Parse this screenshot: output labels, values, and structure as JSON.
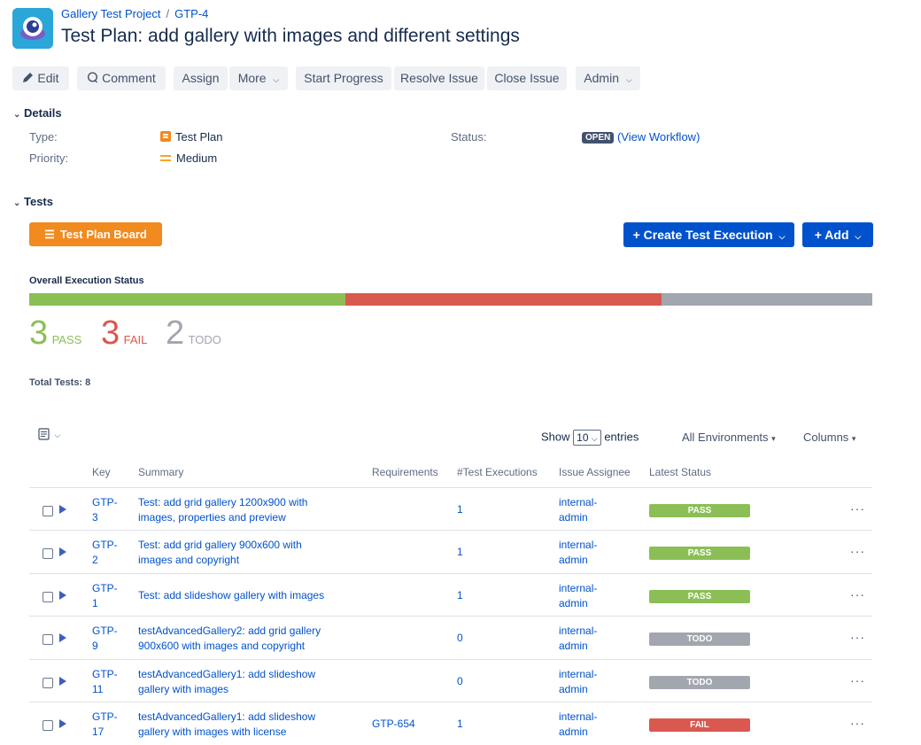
{
  "header": {
    "project": "Gallery Test Project",
    "separator": "/",
    "issue_key": "GTP-4",
    "title": "Test Plan: add gallery with images and different settings"
  },
  "toolbar": {
    "edit": "Edit",
    "comment": "Comment",
    "assign": "Assign",
    "more": "More",
    "start_progress": "Start Progress",
    "resolve_issue": "Resolve Issue",
    "close_issue": "Close Issue",
    "admin": "Admin"
  },
  "details": {
    "heading": "Details",
    "type_label": "Type:",
    "type_value": "Test Plan",
    "priority_label": "Priority:",
    "priority_value": "Medium",
    "status_label": "Status:",
    "status_value": "OPEN",
    "view_workflow": "(View Workflow)"
  },
  "tests": {
    "heading": "Tests",
    "board_button": "Test Plan Board",
    "create_execution": "+ Create Test Execution",
    "add": "+ Add",
    "overall_label": "Overall Execution Status",
    "progress": [
      {
        "status": "PASS",
        "count": 3,
        "fraction": 0.375,
        "color": "#8bbf56"
      },
      {
        "status": "FAIL",
        "count": 3,
        "fraction": 0.375,
        "color": "#d9584f"
      },
      {
        "status": "TODO",
        "count": 2,
        "fraction": 0.25,
        "color": "#a2a6ae"
      }
    ],
    "counts": {
      "pass_num": "3",
      "pass_lbl": "PASS",
      "fail_num": "3",
      "fail_lbl": "FAIL",
      "todo_num": "2",
      "todo_lbl": "TODO"
    },
    "total_tests": "Total Tests: 8"
  },
  "table": {
    "show": "Show",
    "entries_value": "10",
    "entries": "entries",
    "environments": "All Environments",
    "columns": "Columns",
    "headers": {
      "key": "Key",
      "summary": "Summary",
      "requirements": "Requirements",
      "executions": "#Test Executions",
      "assignee": "Issue Assignee",
      "latest_status": "Latest Status"
    },
    "rows": [
      {
        "key1": "GTP-",
        "key2": "3",
        "sum1": "Test: add grid gallery 1200x900 with",
        "sum2": "images, properties and preview",
        "req": "",
        "exec": "1",
        "as1": "internal-",
        "as2": "admin",
        "status": "PASS",
        "color": "#8bbf56"
      },
      {
        "key1": "GTP-",
        "key2": "2",
        "sum1": "Test: add grid gallery 900x600 with",
        "sum2": "images and copyright",
        "req": "",
        "exec": "1",
        "as1": "internal-",
        "as2": "admin",
        "status": "PASS",
        "color": "#8bbf56"
      },
      {
        "key1": "GTP-",
        "key2": "1",
        "sum1": "Test: add slideshow gallery with images",
        "sum2": "",
        "req": "",
        "exec": "1",
        "as1": "internal-",
        "as2": "admin",
        "status": "PASS",
        "color": "#8bbf56"
      },
      {
        "key1": "GTP-",
        "key2": "9",
        "sum1": "testAdvancedGallery2: add grid gallery",
        "sum2": "900x600 with images and copyright",
        "req": "",
        "exec": "0",
        "as1": "internal-",
        "as2": "admin",
        "status": "TODO",
        "color": "#a2a6ae"
      },
      {
        "key1": "GTP-",
        "key2": "11",
        "sum1": "testAdvancedGallery1: add slideshow",
        "sum2": "gallery with images",
        "req": "",
        "exec": "0",
        "as1": "internal-",
        "as2": "admin",
        "status": "TODO",
        "color": "#a2a6ae"
      },
      {
        "key1": "GTP-",
        "key2": "17",
        "sum1": "testAdvancedGallery1: add slideshow",
        "sum2": "gallery with images with license",
        "req": "GTP-654",
        "exec": "1",
        "as1": "internal-",
        "as2": "admin",
        "status": "FAIL",
        "color": "#d9584f"
      }
    ],
    "row_actions": "···"
  }
}
